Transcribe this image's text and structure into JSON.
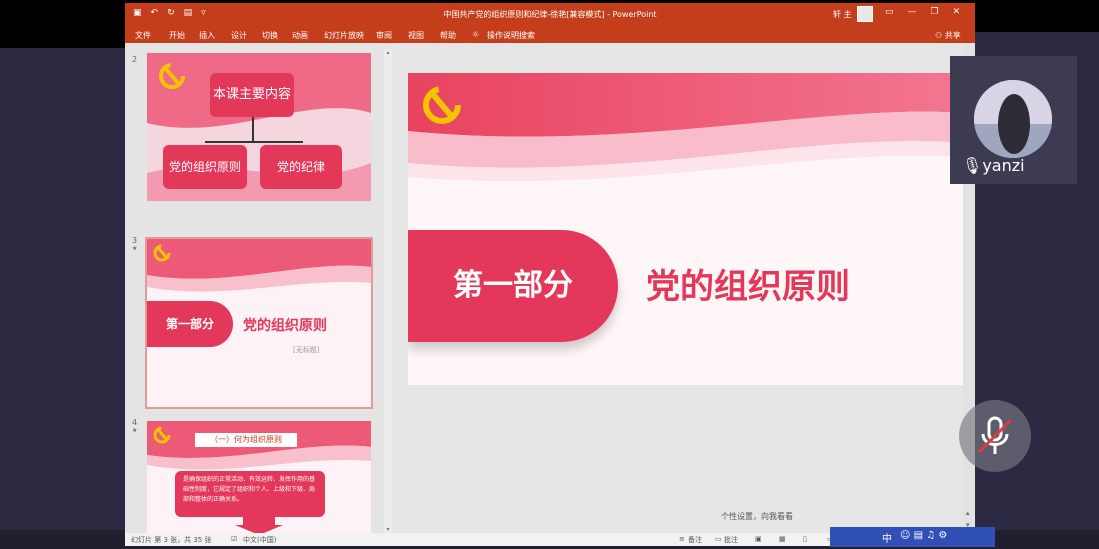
{
  "window": {
    "doc_title": "中国共产党的组织原则和纪律-徐艳[兼容模式] - PowerPoint",
    "user": "轩 主",
    "share": "共享"
  },
  "ribbon": {
    "tabs": [
      "文件",
      "开始",
      "插入",
      "设计",
      "切换",
      "动画",
      "幻灯片放映",
      "审阅",
      "视图",
      "帮助",
      "操作说明搜索"
    ]
  },
  "thumbs": [
    {
      "num": "2",
      "title": "本课主要内容",
      "left_box": "党的组织原则",
      "right_box": "党的纪律"
    },
    {
      "num": "3",
      "banner": "第一部分",
      "heading": "党的组织原则",
      "caption": "[无标题]",
      "star": "★"
    },
    {
      "num": "4",
      "star": "★",
      "header": "（一）何为组织原则",
      "body": "是确保组织的正常活动、有效运转、发挥作用的基础性制度，它规定了组织和个人、上级和下级、局部和整体的正确关系。"
    }
  ],
  "main_slide": {
    "banner": "第一部分",
    "heading": "党的组织原则"
  },
  "status": {
    "slide_info": "幻灯片 第 3 张，共 35 张",
    "language": "中文(中国)",
    "notes": "备注",
    "comments": "批注"
  },
  "overlay": {
    "participant_name": "yanzi",
    "notice": "个性设置，向我看看",
    "ime": "中"
  },
  "colors": {
    "ppt_red": "#c43e1c",
    "slide_red": "#e4385a",
    "emblem_gold": "#f5c400"
  }
}
